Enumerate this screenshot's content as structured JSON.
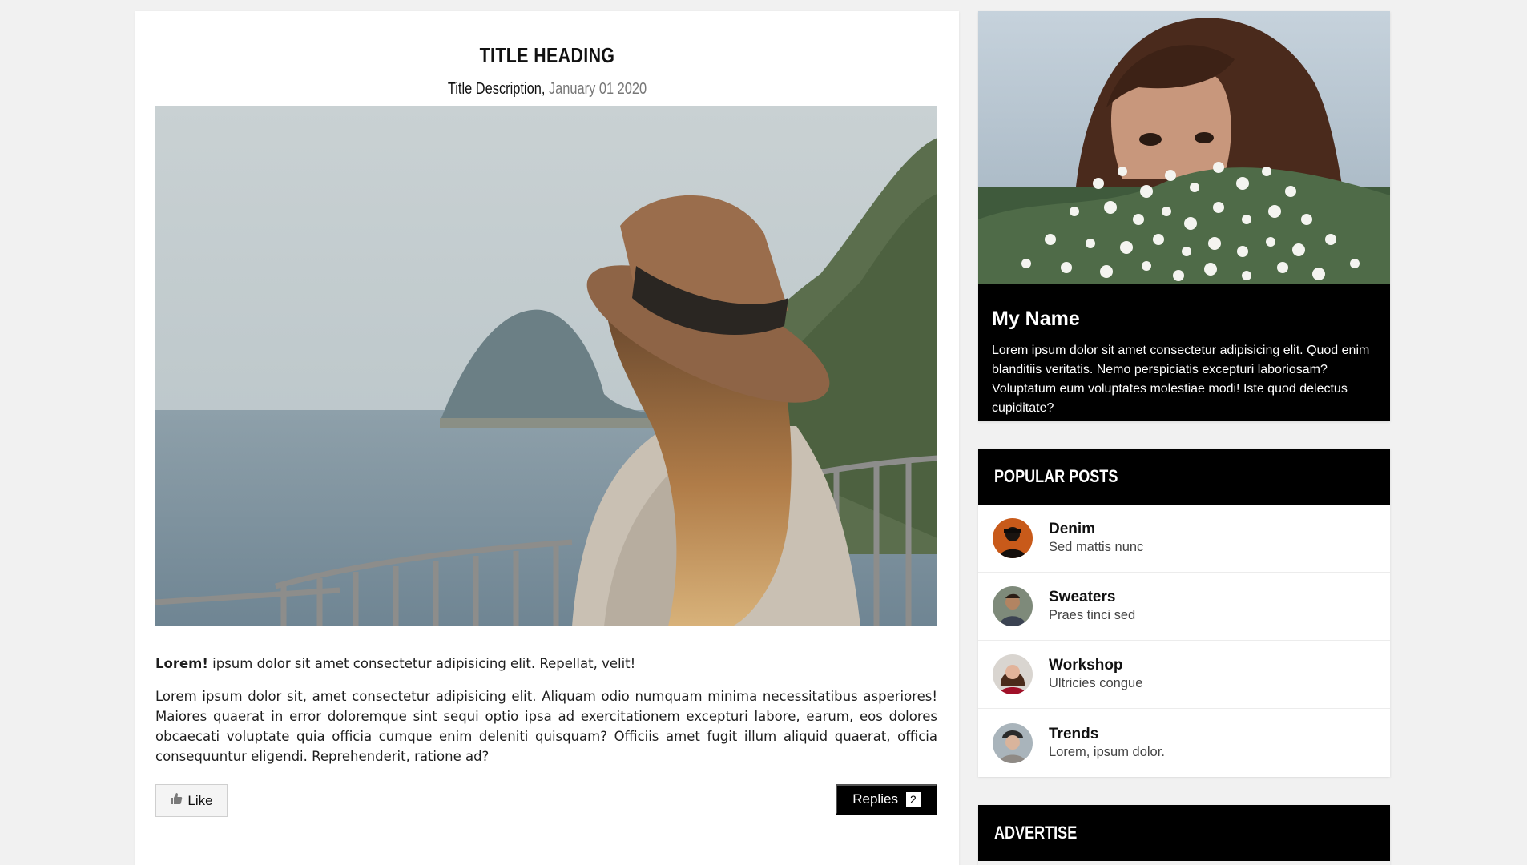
{
  "post": {
    "title": "TITLE HEADING",
    "description": "Title Description,",
    "date": "January 01 2020",
    "lead_bold": "Lorem!",
    "lead_rest": " ipsum dolor sit amet consectetur adipisicing elit. Repellat, velit!",
    "body": "Lorem ipsum dolor sit, amet consectetur adipisicing elit. Aliquam odio numquam minima necessitatibus asperiores! Maiores quaerat in error doloremque sint sequi optio ipsa ad exercitationem excepturi labore, earum, eos dolores obcaecati voluptate quia officia cumque enim deleniti quisquam? Officiis amet fugit illum aliquid quaerat, officia consequuntur eligendi. Reprehenderit, ratione ad?",
    "like_label": "Like",
    "replies_label": "Replies",
    "replies_count": "2"
  },
  "profile": {
    "name": "My Name",
    "bio": "Lorem ipsum dolor sit amet consectetur adipisicing elit. Quod enim blanditiis veritatis. Nemo perspiciatis excepturi laboriosam? Voluptatum eum voluptates molestiae modi! Iste quod delectus cupiditate?"
  },
  "popular": {
    "header": "POPULAR POSTS",
    "items": [
      {
        "title": "Denim",
        "subtitle": "Sed mattis nunc"
      },
      {
        "title": "Sweaters",
        "subtitle": "Praes tinci sed"
      },
      {
        "title": "Workshop",
        "subtitle": "Ultricies congue"
      },
      {
        "title": "Trends",
        "subtitle": "Lorem, ipsum dolor."
      }
    ]
  },
  "advertise": {
    "header": "ADVERTISE"
  },
  "colors": {
    "page_bg": "#f1f1f1",
    "card_bg": "#ffffff",
    "panel_bg": "#000000",
    "date_gray": "#777777"
  }
}
